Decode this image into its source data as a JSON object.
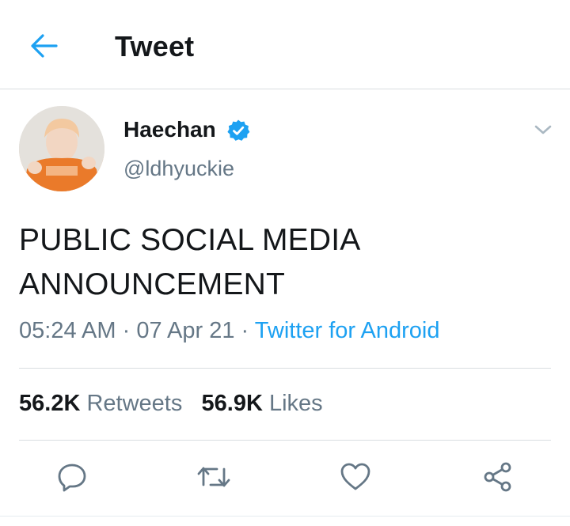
{
  "header": {
    "title": "Tweet",
    "back_icon": "arrow-left-icon"
  },
  "tweet": {
    "author_name": "Haechan",
    "verified": true,
    "handle": "@ldhyuckie",
    "text_line1": "PUBLIC SOCIAL MEDIA",
    "text_line2": "ANNOUNCEMENT",
    "time": "05:24 AM",
    "date": "07 Apr 21",
    "source": "Twitter for Android",
    "separator": "·"
  },
  "stats": {
    "retweets_count": "56.2K",
    "retweets_label": "Retweets",
    "likes_count": "56.9K",
    "likes_label": "Likes"
  },
  "actions": [
    "reply-icon",
    "retweet-icon",
    "like-icon",
    "share-icon"
  ],
  "colors": {
    "accent": "#1da1f2",
    "secondary_text": "#657786",
    "primary_text": "#14171a",
    "divider": "#d9dde0"
  }
}
